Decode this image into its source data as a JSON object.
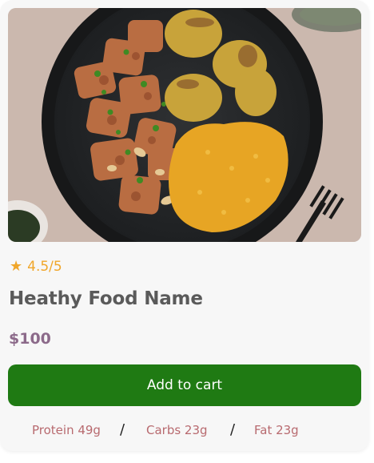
{
  "product": {
    "image_alt": "Plate of chicken, roasted potatoes and saffron rice",
    "rating_text": "4.5/5",
    "name": "Heathy Food Name",
    "price": "$100",
    "add_to_cart_label": "Add to cart"
  },
  "nutrition": {
    "protein": "Protein 49g",
    "carbs": "Carbs 23g",
    "fat": "Fat 23g",
    "separator": "/"
  },
  "colors": {
    "button_bg": "#1f7a13",
    "star": "#f0a62a",
    "price": "#8c6a8a",
    "nutrition_text": "#b86a6f"
  },
  "icons": {
    "rating": "star-icon"
  }
}
